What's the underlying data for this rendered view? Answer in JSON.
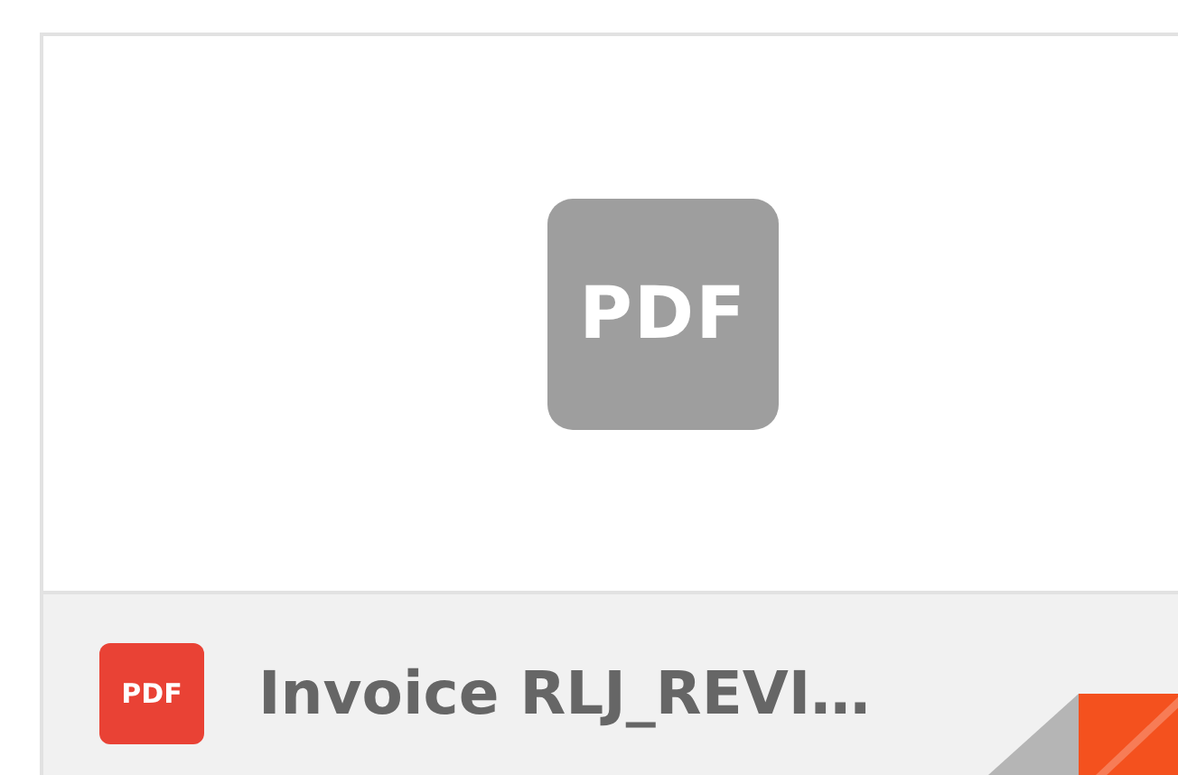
{
  "thumbnail": {
    "label": "PDF"
  },
  "file": {
    "badge": "PDF",
    "name": "Invoice RLJ_REVI…"
  }
}
